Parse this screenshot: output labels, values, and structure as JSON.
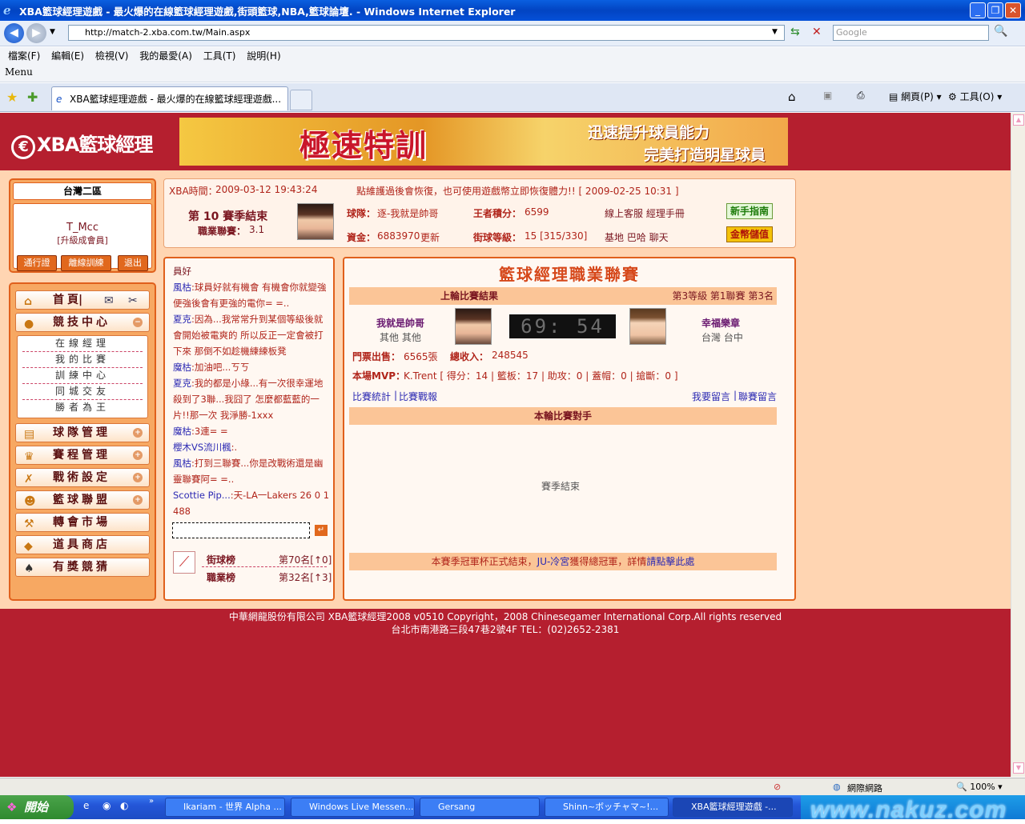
{
  "window": {
    "title": "XBA籃球經理遊戲 - 最火爆的在線籃球經理遊戲,街頭籃球,NBA,籃球論壇. - Windows Internet Explorer"
  },
  "browser": {
    "url": "http://match-2.xba.com.tw/Main.aspx",
    "search_placeholder": "Google",
    "menus": [
      "檔案(F)",
      "編輯(E)",
      "檢視(V)",
      "我的最愛(A)",
      "工具(T)",
      "說明(H)"
    ],
    "menu_label": "Menu",
    "tab_title": "XBA籃球經理遊戲 - 最火爆的在線籃球經理遊戲...",
    "tools": {
      "page": "網頁(P)",
      "tools": "工具(O)"
    }
  },
  "header": {
    "logo": "XBA籃球經理",
    "banner_title": "極速特訓",
    "banner_line1": "迅速提升球員能力",
    "banner_line2": "完美打造明星球員"
  },
  "user": {
    "region": "台灣二區",
    "name": "T_Mcc",
    "rank": "[升級成會員]",
    "buttons": [
      "通行證",
      "離線訓練",
      "退出"
    ]
  },
  "nav": {
    "home": "首頁",
    "competition": "競技中心",
    "sub": [
      "在線經理",
      "我的比賽",
      "訓練中心",
      "同城交友",
      "勝者為王"
    ],
    "team": "球隊管理",
    "schedule": "賽程管理",
    "tactics": "戰術設定",
    "league": "籃球聯盟",
    "transfer": "轉會市場",
    "shop": "道具商店",
    "lottery": "有獎競猜"
  },
  "info": {
    "time_label": "XBA時間：",
    "time": "2009-03-12 19:43:24",
    "notice": "點維護過後會恢復，也可使用遊戲幣立即恢復體力!! [ 2009-02-25 10:31 ]",
    "season": "第 10 賽季結束",
    "league_label": "職業聯賽：",
    "league_value": "3.1",
    "team_label": "球隊：",
    "team_value": "逐-我就是帥哥",
    "king_label": "王者積分：",
    "king_value": "6599",
    "links1": "線上客服  經理手冊",
    "fund_label": "資金：",
    "fund_value": "6883970",
    "update": "更新",
    "street_label": "街球等級：",
    "street_value": "15 [315/330]",
    "links2": "基地  巴哈  聊天",
    "guide_btn": "新手指南",
    "coin_btn": "金幣儲值"
  },
  "chat": {
    "greeting": "員好",
    "messages": [
      {
        "who": "風枯",
        "text": ":球員好就有機會  有機會你就變強  便強後會有更強的電你= =.."
      },
      {
        "who": "夏克",
        "text": ":因為...我常常升到某個等級後就會開始被電爽的  所以反正一定會被打下來  那倒不如趁機練練板凳"
      },
      {
        "who": "魔枯",
        "text": ":加油吧...ㄎㄎ"
      },
      {
        "who": "夏克",
        "text": ":我的都是小綠...有一次很幸運地殺到了3聯...我囧了  怎麼都藍藍的一片!!那一次  我淨勝-1xxx"
      },
      {
        "who": "魔枯",
        "text": ":3連= ="
      },
      {
        "who": "櫻木VS流川楓",
        "text": ":."
      },
      {
        "who": "風枯",
        "text": ":打到三聯賽...你是改戰術還是幽靈聯賽阿= =.."
      },
      {
        "who": "Scottie Pip...",
        "text": ":天-LA一Lakers 26 0 1 488"
      }
    ],
    "rank1_label": "街球榜",
    "rank1_value": "第70名[↑0]",
    "rank2_label": "職業榜",
    "rank2_value": "第32名[↑3]"
  },
  "match": {
    "title": "籃球經理職業聯賽",
    "last_result": "上輪比賽結果",
    "level_info": "第3等級  第1聯賽  第3名",
    "home_team": "我就是帥哥",
    "home_loc": "其他  其他",
    "away_team": "幸福樂章",
    "away_loc": "台灣  台中",
    "score": "69: 54",
    "ticket_label": "門票出售：",
    "ticket_value": "6565張",
    "income_label": "總收入：",
    "income_value": "248545",
    "mvp_label": "本場MVP：",
    "mvp_value": "K.Trent [ 得分：14 | 籃板：17 | 助攻：0 | 蓋帽：0 | 搶斷：0 ]",
    "stats_link": "比賽統計",
    "report_link": "比賽戰報",
    "msg_link": "我要留言",
    "msg2_link": "聯賽留言",
    "opponent": "本輪比賽對手",
    "season_end": "賽季結束",
    "champion_prefix": "本賽季冠軍杯正式結束，",
    "champion_team": "JU-冷宮",
    "champion_mid": "獲得總冠軍，詳情",
    "champion_link": "請點擊此處"
  },
  "footer": {
    "line1": "中華網龍股份有限公司  XBA籃球經理2008 v0510     Copyright，2008 Chinesegamer International Corp.All rights reserved",
    "line2": "台北市南港路三段47巷2號4F TEL：(02)2652-2381"
  },
  "status": {
    "zone": "網際網路",
    "zoom": "100%"
  },
  "taskbar": {
    "start": "開始",
    "tasks": [
      "Ikariam - 世界 Alpha ...",
      "Windows Live Messen...",
      "Gersang",
      "Shinn~ボッチャマ~!...",
      "XBA籃球經理遊戲 -..."
    ],
    "watermark": "www.nakuz.com"
  }
}
